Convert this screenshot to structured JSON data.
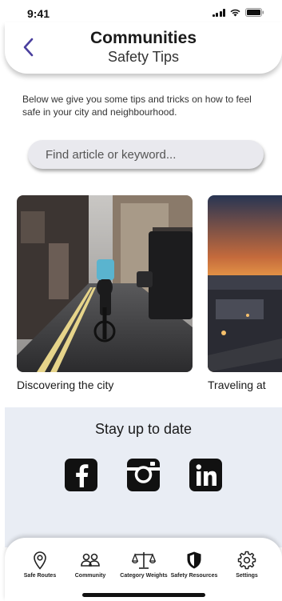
{
  "status_bar": {
    "time": "9:41"
  },
  "header": {
    "title": "Communities",
    "subtitle": "Safety Tips"
  },
  "intro": {
    "text": "Below we give you some tips and tricks on how to feel safe in your city and neighbourhood."
  },
  "search": {
    "placeholder": "Find article or keyword..."
  },
  "articles": [
    {
      "caption": "Discovering the city",
      "image": "city-street-cyclist-photo"
    },
    {
      "caption": "Traveling at",
      "image": "sunset-city-photo"
    }
  ],
  "social": {
    "title": "Stay up to date",
    "icons": [
      "facebook-icon",
      "instagram-icon",
      "linkedin-icon"
    ]
  },
  "nav": {
    "items": [
      {
        "label": "Safe Routes",
        "icon": "location-pin-icon"
      },
      {
        "label": "Community",
        "icon": "people-icon"
      },
      {
        "label": "Category Weights",
        "icon": "scale-icon"
      },
      {
        "label": "Safety Resources",
        "icon": "shield-icon"
      },
      {
        "label": "Settings",
        "icon": "gear-icon"
      }
    ]
  },
  "colors": {
    "accent": "#4a3f9e",
    "section_bg": "#e9edf4",
    "search_bg": "#e9e9ee"
  }
}
